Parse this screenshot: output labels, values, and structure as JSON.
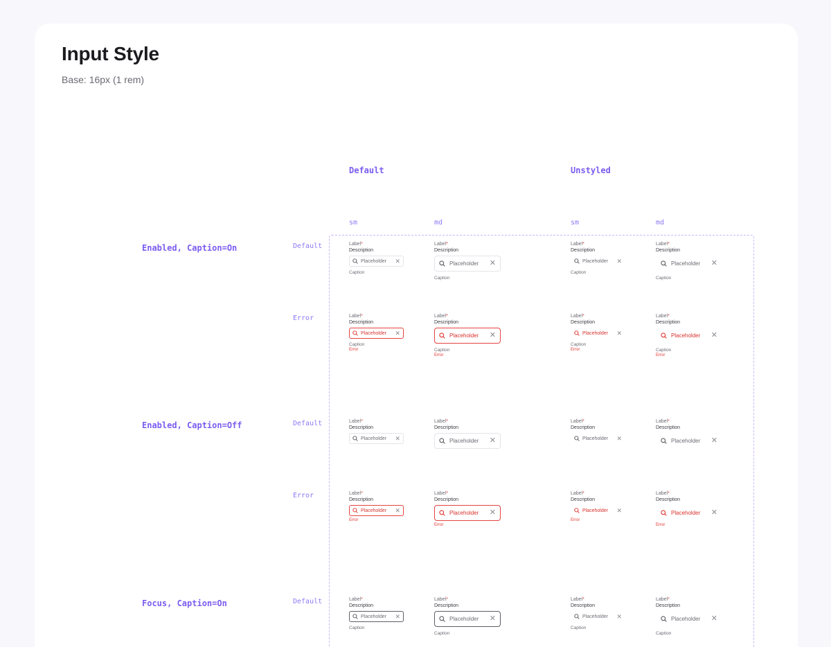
{
  "page": {
    "title": "Input Style",
    "subtitle": "Base: 16px (1 rem)"
  },
  "columns": {
    "default": "Default",
    "unstyled": "Unstyled",
    "sizes": {
      "sm": "sm",
      "md": "md"
    }
  },
  "groups": {
    "caption_on": "Enabled, Caption=On",
    "caption_off": "Enabled, Caption=Off",
    "focus_on": "Focus, Caption=On"
  },
  "states": {
    "default": "Default",
    "error": "Error"
  },
  "field": {
    "label": "Label",
    "required_mark": "*",
    "description": "Description",
    "placeholder": "Placeholder",
    "caption": "Caption",
    "error": "Error",
    "clear_glyph": "✕"
  },
  "colors": {
    "accent": "#7b5cf0",
    "error": "#e0342f",
    "frame": "#c9b6fb"
  }
}
